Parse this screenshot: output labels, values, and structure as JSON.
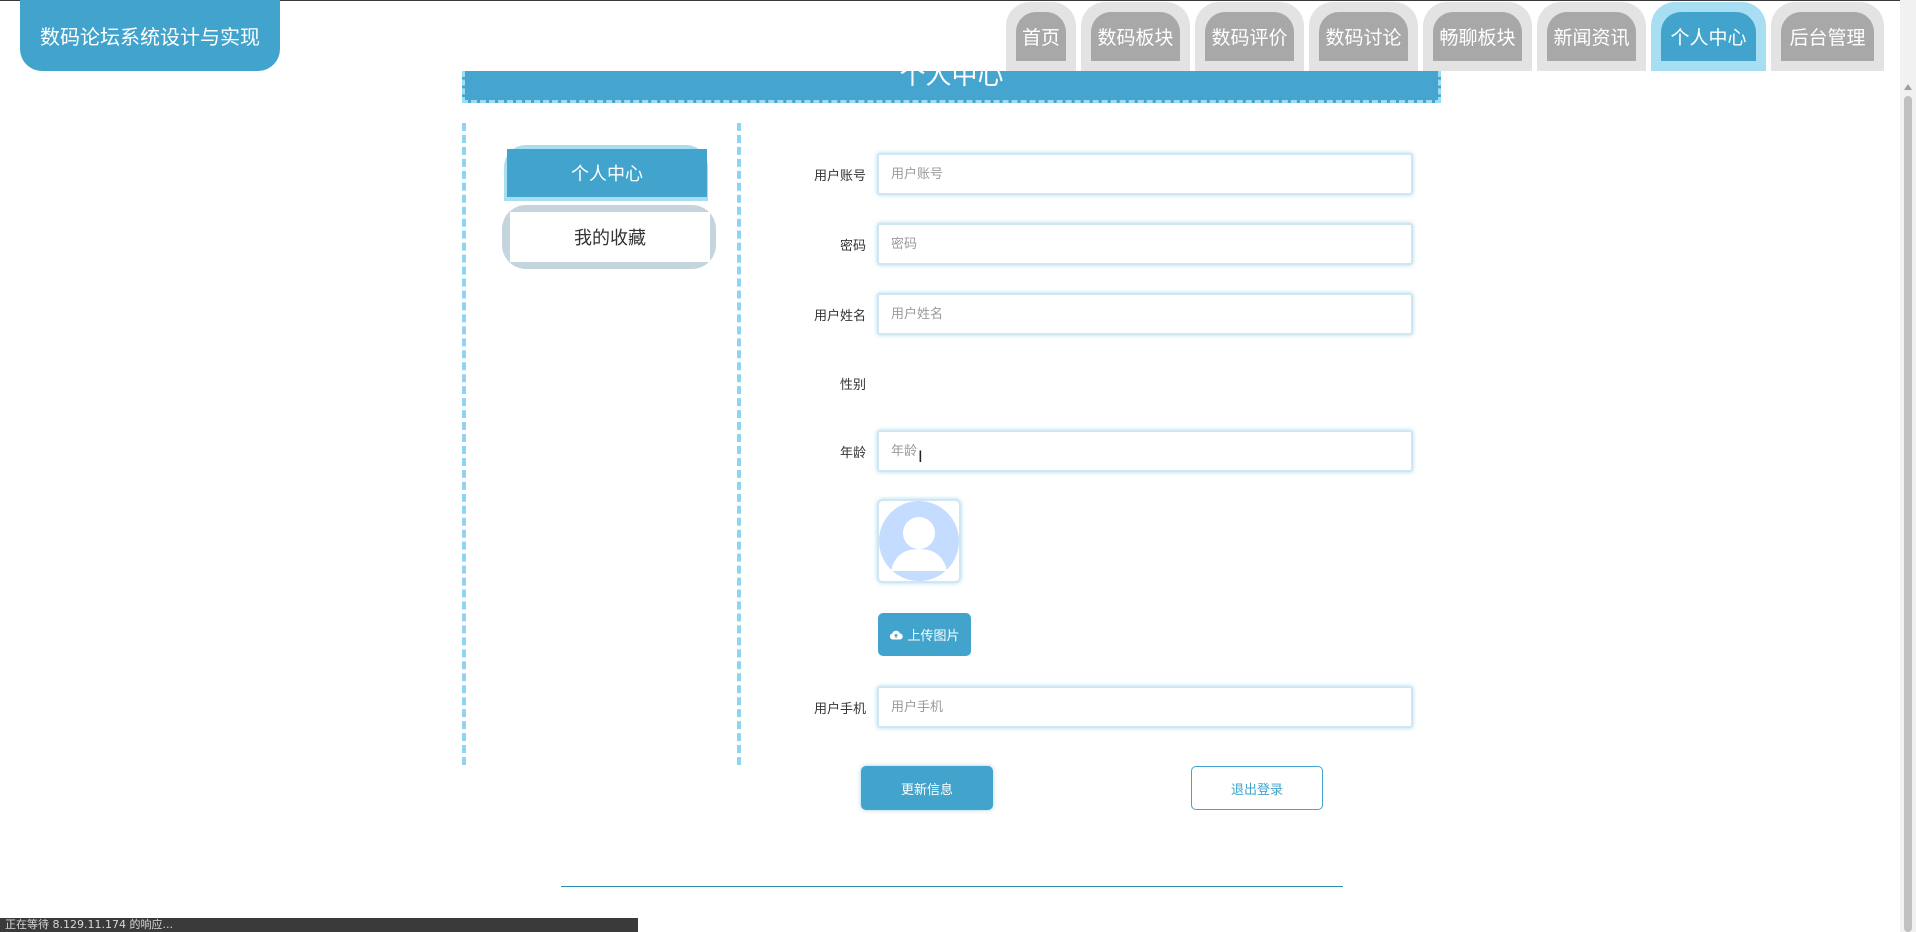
{
  "header": {
    "site_title": "数码论坛系统设计与实现",
    "nav": [
      {
        "label": "首页",
        "active": false
      },
      {
        "label": "数码板块",
        "active": false
      },
      {
        "label": "数码评价",
        "active": false
      },
      {
        "label": "数码讨论",
        "active": false
      },
      {
        "label": "畅聊板块",
        "active": false
      },
      {
        "label": "新闻资讯",
        "active": false
      },
      {
        "label": "个人中心",
        "active": true
      },
      {
        "label": "后台管理",
        "active": false
      }
    ]
  },
  "banner": {
    "title": "个人中心"
  },
  "sidebar": {
    "items": [
      {
        "label": "个人中心",
        "active": true
      },
      {
        "label": "我的收藏",
        "active": false
      }
    ]
  },
  "form": {
    "account": {
      "label": "用户账号",
      "placeholder": "用户账号",
      "value": ""
    },
    "password": {
      "label": "密码",
      "placeholder": "密码",
      "value": ""
    },
    "name": {
      "label": "用户姓名",
      "placeholder": "用户姓名",
      "value": ""
    },
    "gender": {
      "label": "性别"
    },
    "age": {
      "label": "年龄",
      "placeholder": "年龄",
      "value": ""
    },
    "avatar": {
      "icon": "user-avatar-placeholder"
    },
    "upload_label": "上传图片",
    "upload_icon": "cloud-upload-icon",
    "phone": {
      "label": "用户手机",
      "placeholder": "用户手机",
      "value": ""
    },
    "update_label": "更新信息",
    "logout_label": "退出登录"
  },
  "status_bar": {
    "text": "正在等待 8.129.11.174 的响应..."
  },
  "colors": {
    "accent": "#42a4cd",
    "accent_light": "#a8def2",
    "nav_inactive": "#a8a8a8",
    "dashed_border": "#8fd5f1"
  }
}
